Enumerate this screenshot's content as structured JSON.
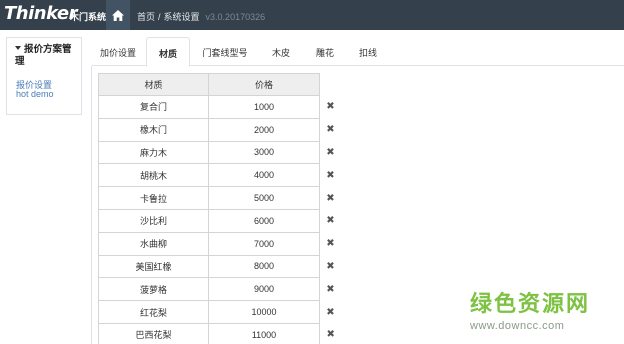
{
  "navbar": {
    "brand": "Thinker",
    "brand_sub": "木门系统",
    "breadcrumb": [
      "首页",
      "系统设置"
    ],
    "separator": "/",
    "version": "v3.0.20170326",
    "home_icon": "home-icon"
  },
  "sidebar": {
    "heading": "报价方案管理",
    "links": [
      "报价设置",
      "hot demo"
    ]
  },
  "tabs": [
    "加价设置",
    "材质",
    "门套线型号",
    "木皮",
    "雕花",
    "扣线"
  ],
  "active_tab": "材质",
  "table": {
    "headers": [
      "材质",
      "价格"
    ],
    "rows": [
      [
        "复合门",
        "1000"
      ],
      [
        "橡木门",
        "2000"
      ],
      [
        "麻力木",
        "3000"
      ],
      [
        "胡桃木",
        "4000"
      ],
      [
        "卡鲁拉",
        "5000"
      ],
      [
        "沙比利",
        "6000"
      ],
      [
        "水曲柳",
        "7000"
      ],
      [
        "美国红橡",
        "8000"
      ],
      [
        "菠萝格",
        "9000"
      ],
      [
        "红花梨",
        "10000"
      ],
      [
        "巴西花梨",
        "11000"
      ]
    ],
    "delete_glyph": "✖"
  },
  "watermark": {
    "title": "绿色资源网",
    "url": "www.downcc.com"
  }
}
